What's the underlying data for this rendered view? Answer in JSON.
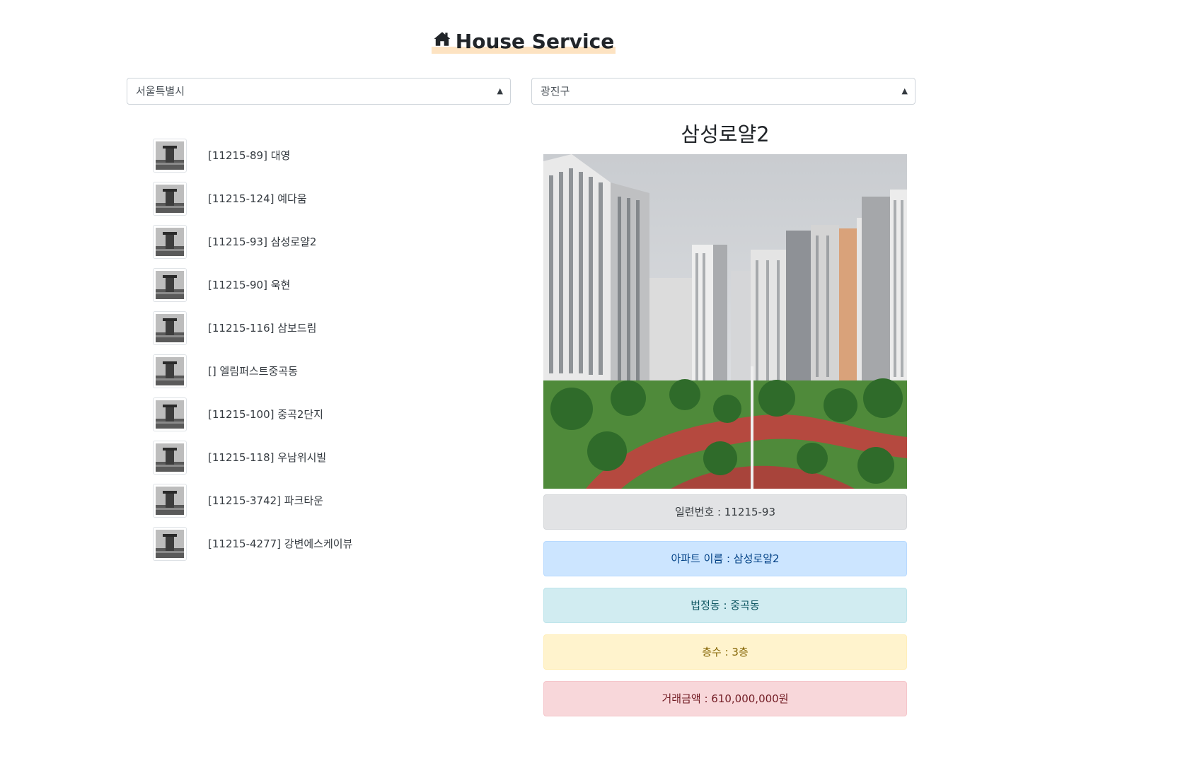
{
  "header": {
    "title": "House Service",
    "icon": "house-icon"
  },
  "selects": {
    "sido": "서울특별시",
    "gugun": "광진구"
  },
  "apartments": [
    {
      "label": "[11215-89] 대영"
    },
    {
      "label": "[11215-124] 예다움"
    },
    {
      "label": "[11215-93] 삼성로얄2"
    },
    {
      "label": "[11215-90] 욱현"
    },
    {
      "label": "[11215-116] 삼보드림"
    },
    {
      "label": "[] 엘림퍼스트중곡동"
    },
    {
      "label": "[11215-100] 중곡2단지"
    },
    {
      "label": "[11215-118] 우남위시빌"
    },
    {
      "label": "[11215-3742] 파크타운"
    },
    {
      "label": "[11215-4277] 강변에스케이뷰"
    }
  ],
  "detail": {
    "title": "삼성로얄2",
    "serial": "일련번호 : 11215-93",
    "name": "아파트 이름 : 삼성로얄2",
    "dong": "법정동 : 중곡동",
    "floor": "층수 : 3층",
    "price": "거래금액 : 610,000,000원"
  },
  "colors": {
    "gray": "#e2e3e5",
    "blue": "#cce5ff",
    "teal": "#d1ecf1",
    "yellow": "#fff3cd",
    "red": "#f8d7da",
    "title_highlight": "#fde3c2"
  }
}
